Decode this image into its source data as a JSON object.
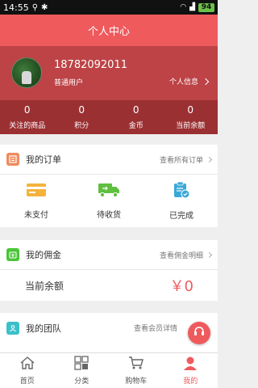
{
  "status": {
    "time": "14:55",
    "battery": "94"
  },
  "header": {
    "title": "个人中心"
  },
  "profile": {
    "phone": "18782092011",
    "role": "普通用户",
    "info_link": "个人信息"
  },
  "stats": [
    {
      "value": "0",
      "label": "关注的商品"
    },
    {
      "value": "0",
      "label": "积分"
    },
    {
      "value": "0",
      "label": "金币"
    },
    {
      "value": "0",
      "label": "当前余额"
    }
  ],
  "orders": {
    "title": "我的订单",
    "more": "查看所有订单",
    "items": [
      {
        "label": "未支付",
        "icon": "card-icon"
      },
      {
        "label": "待收货",
        "icon": "truck-icon"
      },
      {
        "label": "已完成",
        "icon": "clipboard-icon"
      }
    ]
  },
  "commission": {
    "title": "我的佣金",
    "more": "查看佣金明细",
    "balance_label": "当前余额",
    "balance_value": "￥0"
  },
  "team": {
    "title": "我的团队",
    "more": "查看会员详情"
  },
  "tabs": [
    {
      "label": "首页",
      "icon": "home-icon"
    },
    {
      "label": "分类",
      "icon": "grid-icon"
    },
    {
      "label": "购物车",
      "icon": "cart-icon"
    },
    {
      "label": "我的",
      "icon": "user-icon"
    }
  ],
  "colors": {
    "brand": "#ef5a5d",
    "profile_bg": "#bd4346",
    "stats_bg": "#9b3033"
  }
}
